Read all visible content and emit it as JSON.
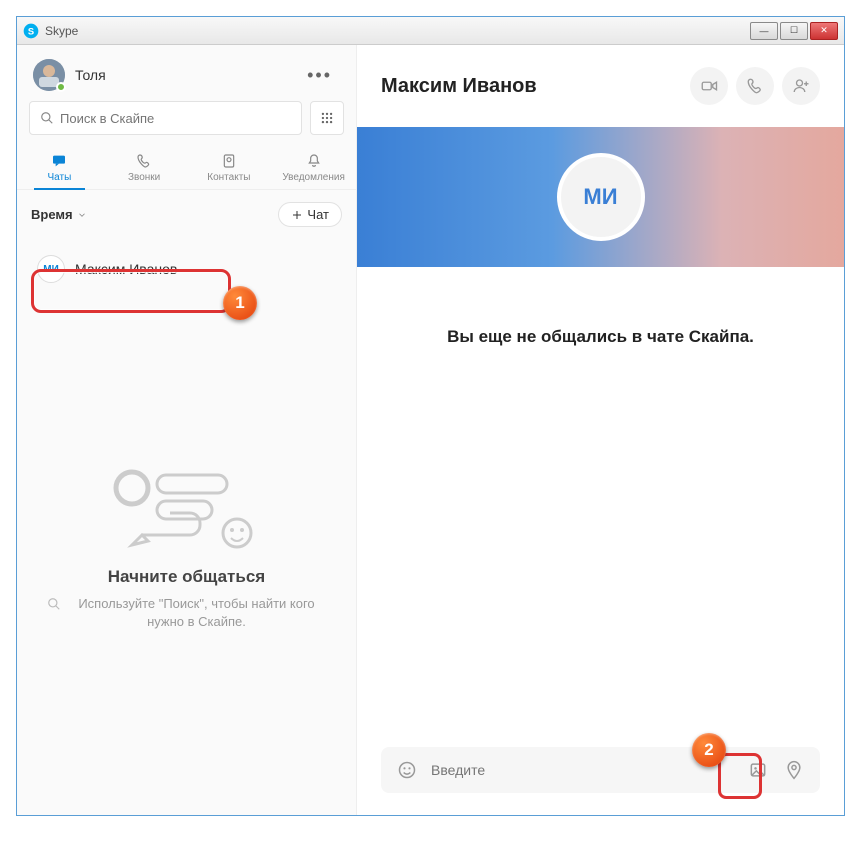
{
  "window": {
    "title": "Skype"
  },
  "user": {
    "name": "Толя"
  },
  "search": {
    "placeholder": "Поиск в Скайпе"
  },
  "tabs": [
    {
      "label": "Чаты"
    },
    {
      "label": "Звонки"
    },
    {
      "label": "Контакты"
    },
    {
      "label": "Уведомления"
    }
  ],
  "filter": {
    "label": "Время",
    "new_chat": "Чат"
  },
  "chat_list": [
    {
      "initials": "МИ",
      "name": "Максим Иванов"
    }
  ],
  "empty": {
    "title": "Начните общаться",
    "subtitle": "Используйте \"Поиск\", чтобы найти кого нужно в Скайпе."
  },
  "conversation": {
    "title": "Максим Иванов",
    "avatar_initials": "МИ",
    "no_messages": "Вы еще не общались в чате Скайпа."
  },
  "composer": {
    "placeholder": "Введите"
  },
  "markers": {
    "one": "1",
    "two": "2"
  }
}
